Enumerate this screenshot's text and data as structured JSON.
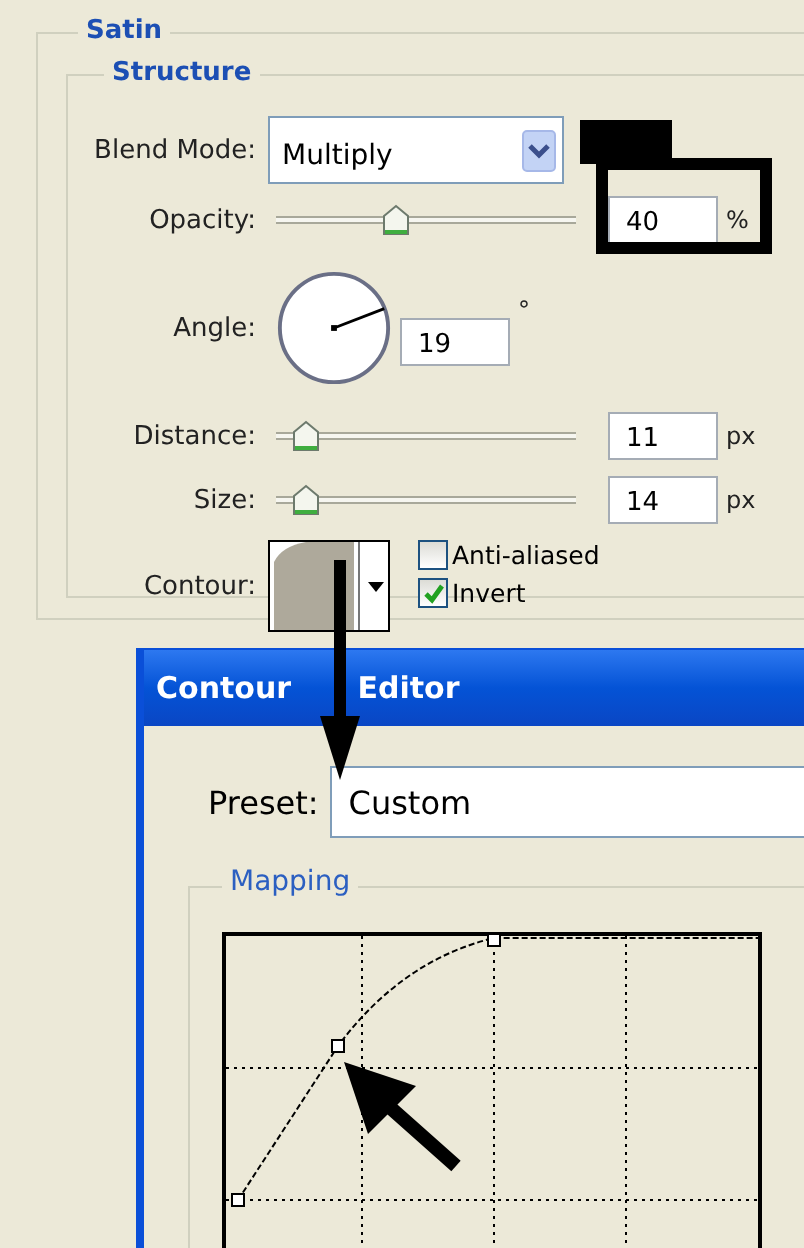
{
  "panel": {
    "title": "Satin",
    "section": "Structure",
    "blend_mode": {
      "label": "Blend Mode:",
      "value": "Multiply"
    },
    "controls": [
      {
        "kind": "slider",
        "label": "Opacity:",
        "level": 0.4,
        "value": "40",
        "unit": "%"
      },
      {
        "kind": "angle",
        "label": "Angle:",
        "value": "19",
        "unit": "°"
      },
      {
        "kind": "slider",
        "label": "Distance:",
        "level": 0.1,
        "value": "11",
        "unit": "px"
      },
      {
        "kind": "slider",
        "label": "Size:",
        "level": 0.1,
        "value": "14",
        "unit": "px"
      }
    ],
    "contour": {
      "label": "Contour:"
    },
    "checkboxes": [
      {
        "label": "Anti-aliased",
        "checked": false
      },
      {
        "label": "Invert",
        "checked": true
      }
    ]
  },
  "contour_editor": {
    "title": "Contour Editor",
    "preset": {
      "label": "Preset:",
      "value": "Custom"
    },
    "mapping": {
      "title": "Mapping"
    }
  }
}
